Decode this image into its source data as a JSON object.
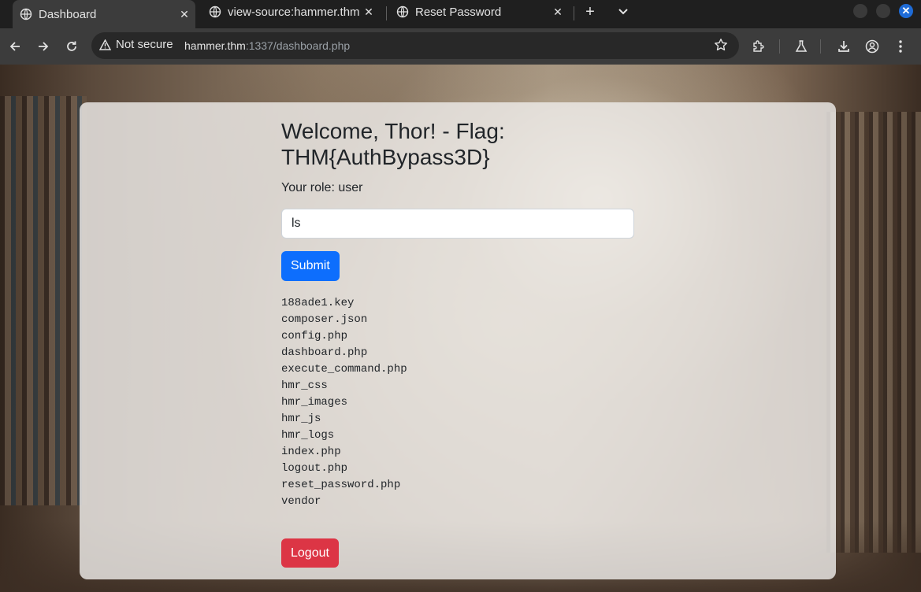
{
  "browser": {
    "tabs": [
      {
        "title": "Dashboard",
        "active": true
      },
      {
        "title": "view-source:hammer.thm",
        "active": false
      },
      {
        "title": "Reset Password",
        "active": false
      }
    ],
    "address": {
      "security_label": "Not secure",
      "host": "hammer.thm",
      "rest": ":1337/dashboard.php"
    }
  },
  "page": {
    "heading": "Welcome, Thor! - Flag: THM{AuthBypass3D}",
    "role_text": "Your role: user",
    "command_value": "ls",
    "submit_label": "Submit",
    "output_lines": [
      "188ade1.key",
      "composer.json",
      "config.php",
      "dashboard.php",
      "execute_command.php",
      "hmr_css",
      "hmr_images",
      "hmr_js",
      "hmr_logs",
      "index.php",
      "logout.php",
      "reset_password.php",
      "vendor"
    ],
    "logout_label": "Logout"
  },
  "colors": {
    "primary": "#0d6efd",
    "danger": "#dc3545",
    "chrome_toolbar": "#3c3c3c",
    "chrome_tabstrip": "#1f1f1f"
  }
}
